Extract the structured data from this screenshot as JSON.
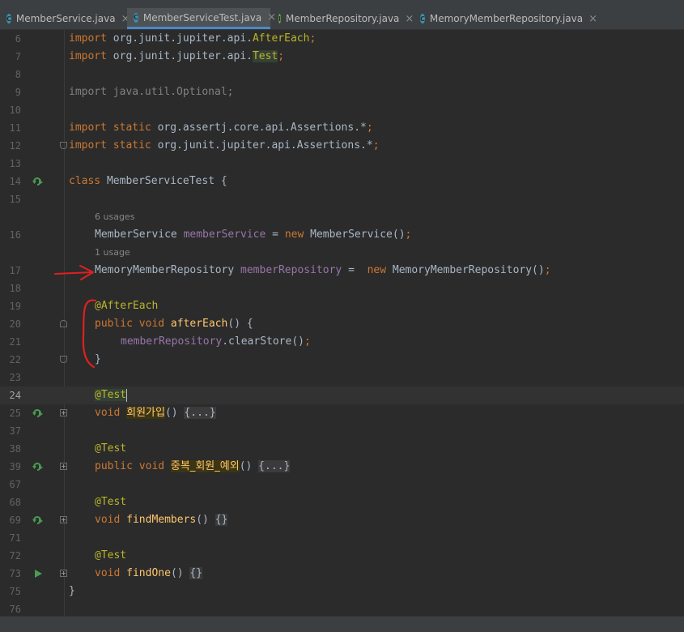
{
  "tabs": [
    {
      "name": "MemberService.java",
      "icon": "class-file-icon",
      "active": false
    },
    {
      "name": "MemberServiceTest.java",
      "icon": "test-class-file-icon",
      "active": true
    },
    {
      "name": "MemberRepository.java",
      "icon": "interface-file-icon",
      "active": false
    },
    {
      "name": "MemoryMemberRepository.java",
      "icon": "class-file-icon",
      "active": false
    }
  ],
  "tab_close_glyph": "×",
  "lines": {
    "l6": {
      "num": "6",
      "imp": "import",
      "pkg": " org.junit.jupiter.api.",
      "cls": "AfterEach",
      "semi": ";"
    },
    "l7": {
      "num": "7",
      "imp": "import",
      "pkg": " org.junit.jupiter.api.",
      "cls": "Test",
      "semi": ";"
    },
    "l8": {
      "num": "8"
    },
    "l9": {
      "num": "9",
      "text": "import java.util.Optional;"
    },
    "l10": {
      "num": "10"
    },
    "l11": {
      "num": "11",
      "imp": "import static",
      "pkg": " org.assertj.core.api.Assertions.*",
      "semi": ";"
    },
    "l12": {
      "num": "12",
      "imp": "import static",
      "pkg": " org.junit.jupiter.api.Assertions.*",
      "semi": ";"
    },
    "l13": {
      "num": "13"
    },
    "l14": {
      "num": "14",
      "kw": "class",
      "rest": " MemberServiceTest {"
    },
    "l15": {
      "num": "15"
    },
    "hint16": "6 usages",
    "l16": {
      "num": "16",
      "type": "MemberService ",
      "field": "memberService",
      "eq": " = ",
      "kw": "new",
      "rest": " MemberService()",
      "semi": ";"
    },
    "hint17": "1 usage",
    "l17": {
      "num": "17",
      "type": "MemoryMemberRepository ",
      "field": "memberRepository",
      "eq": " =  ",
      "kw": "new",
      "rest": " MemoryMemberRepository()",
      "semi": ";"
    },
    "l18": {
      "num": "18"
    },
    "l19": {
      "num": "19",
      "ann": "@AfterEach"
    },
    "l20": {
      "num": "20",
      "kw": "public void",
      "fn": "afterEach",
      "rest": "() {"
    },
    "l21": {
      "num": "21",
      "field": "memberRepository",
      "rest": ".clearStore()",
      "semi": ";"
    },
    "l22": {
      "num": "22",
      "text": "}"
    },
    "l23": {
      "num": "23"
    },
    "l24": {
      "num": "24",
      "ann": "@Test"
    },
    "l25": {
      "num": "25",
      "kw": "void",
      "fn": "회원가입",
      "rest": "() ",
      "fold": "{...}"
    },
    "l37": {
      "num": "37"
    },
    "l38": {
      "num": "38",
      "ann": "@Test"
    },
    "l39": {
      "num": "39",
      "kw": "public void",
      "fn": "중복_회원_예외",
      "rest": "() ",
      "fold": "{...}"
    },
    "l67": {
      "num": "67"
    },
    "l68": {
      "num": "68",
      "ann": "@Test"
    },
    "l69": {
      "num": "69",
      "kw": "void",
      "fn": "findMembers",
      "rest": "() ",
      "fold": "{}"
    },
    "l71": {
      "num": "71"
    },
    "l72": {
      "num": "72",
      "ann": "@Test"
    },
    "l73": {
      "num": "73",
      "kw": "void",
      "fn": "findOne",
      "rest": "() ",
      "fold": "{}"
    },
    "l75": {
      "num": "75",
      "text": "}"
    },
    "l76": {
      "num": "76"
    }
  },
  "colors": {
    "background": "#2b2b2b",
    "keyword": "#cc7832",
    "field": "#9876aa",
    "annotation": "#bbb529",
    "method": "#ffc66d",
    "annotation_marker": "#e02020",
    "run_gutter": "#499c54"
  }
}
